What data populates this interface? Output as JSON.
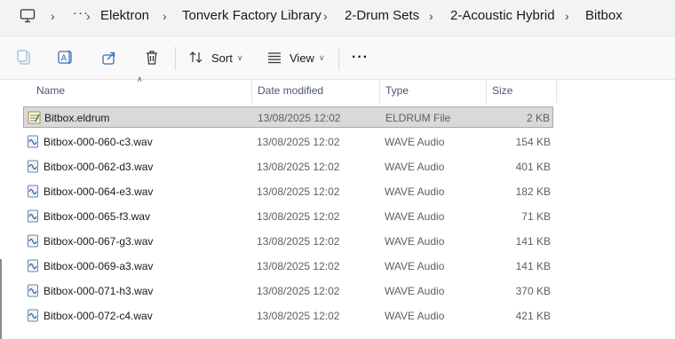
{
  "breadcrumb": {
    "overflow": "···",
    "items": [
      "Elektron",
      "Tonverk Factory Library",
      "2-Drum Sets",
      "2-Acoustic Hybrid",
      "Bitbox"
    ]
  },
  "toolbar": {
    "sort_label": "Sort",
    "view_label": "View",
    "more_label": "···",
    "icons": [
      "copy-icon",
      "rename-icon",
      "share-icon",
      "delete-icon",
      "sort-icon",
      "view-icon"
    ]
  },
  "columns": {
    "name": "Name",
    "date": "Date modified",
    "type": "Type",
    "size": "Size"
  },
  "files": [
    {
      "name": "Bitbox.eldrum",
      "date": "13/08/2025 12:02",
      "type": "ELDRUM File",
      "size": "2 KB",
      "kind": "eldrum"
    },
    {
      "name": "Bitbox-000-060-c3.wav",
      "date": "13/08/2025 12:02",
      "type": "WAVE Audio",
      "size": "154 KB",
      "kind": "wav"
    },
    {
      "name": "Bitbox-000-062-d3.wav",
      "date": "13/08/2025 12:02",
      "type": "WAVE Audio",
      "size": "401 KB",
      "kind": "wav"
    },
    {
      "name": "Bitbox-000-064-e3.wav",
      "date": "13/08/2025 12:02",
      "type": "WAVE Audio",
      "size": "182 KB",
      "kind": "wav"
    },
    {
      "name": "Bitbox-000-065-f3.wav",
      "date": "13/08/2025 12:02",
      "type": "WAVE Audio",
      "size": "71 KB",
      "kind": "wav"
    },
    {
      "name": "Bitbox-000-067-g3.wav",
      "date": "13/08/2025 12:02",
      "type": "WAVE Audio",
      "size": "141 KB",
      "kind": "wav"
    },
    {
      "name": "Bitbox-000-069-a3.wav",
      "date": "13/08/2025 12:02",
      "type": "WAVE Audio",
      "size": "141 KB",
      "kind": "wav"
    },
    {
      "name": "Bitbox-000-071-h3.wav",
      "date": "13/08/2025 12:02",
      "type": "WAVE Audio",
      "size": "370 KB",
      "kind": "wav"
    },
    {
      "name": "Bitbox-000-072-c4.wav",
      "date": "13/08/2025 12:02",
      "type": "WAVE Audio",
      "size": "421 KB",
      "kind": "wav"
    }
  ],
  "selected_index": 0
}
